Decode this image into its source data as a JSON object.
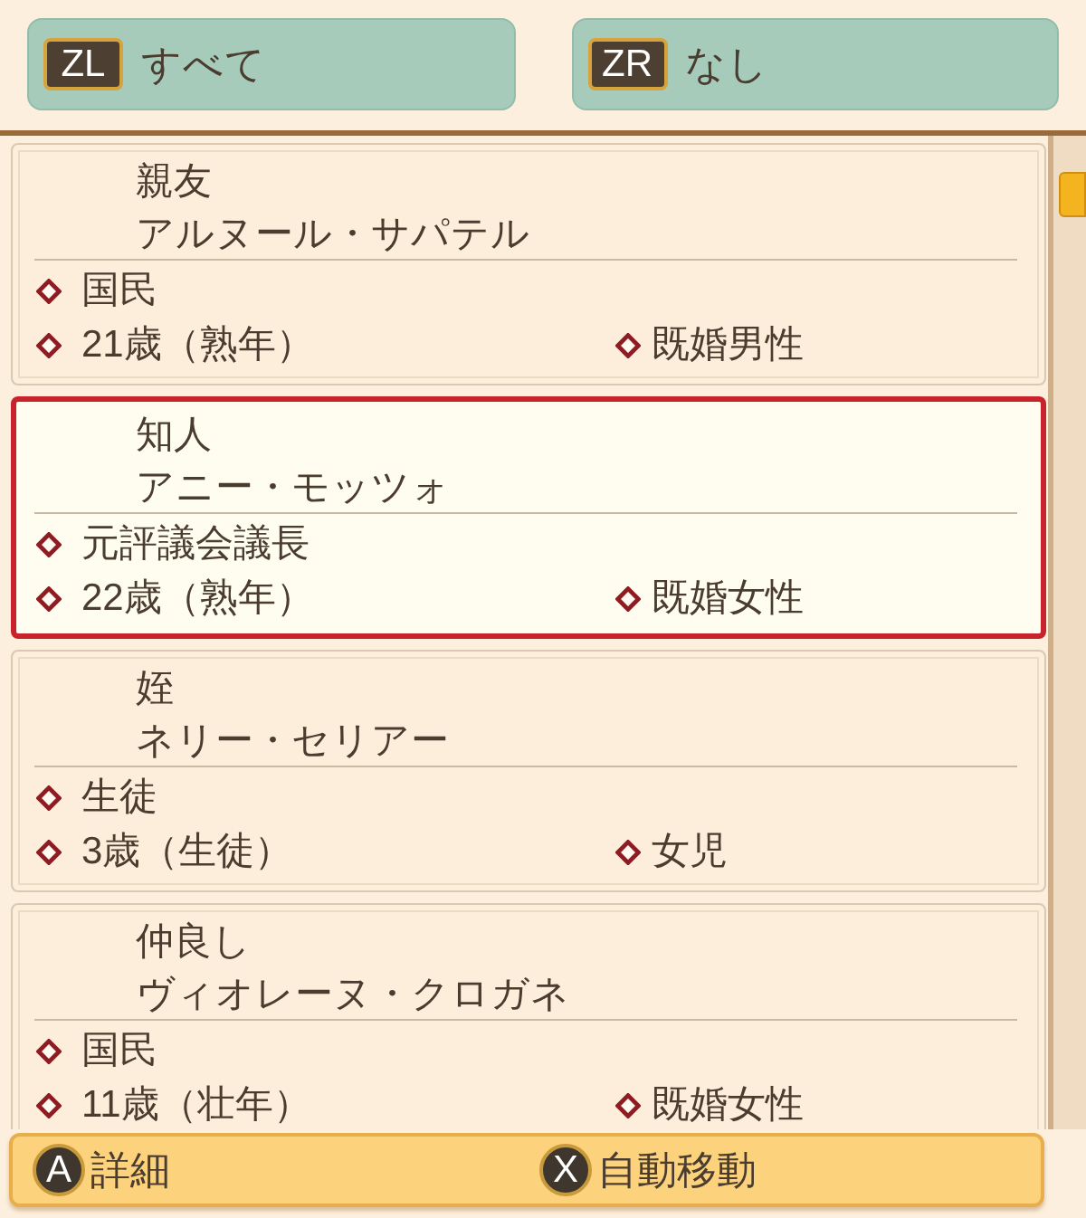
{
  "filter_buttons": [
    {
      "key": "ZL",
      "label": "すべて"
    },
    {
      "key": "ZR",
      "label": "なし"
    }
  ],
  "people": [
    {
      "relation": "親友",
      "name": "アルヌール・サパテル",
      "title": "国民",
      "age": "21歳（熟年）",
      "status": "既婚男性",
      "selected": false
    },
    {
      "relation": "知人",
      "name": "アニー・モッツォ",
      "title": "元評議会議長",
      "age": "22歳（熟年）",
      "status": "既婚女性",
      "selected": true
    },
    {
      "relation": "姪",
      "name": "ネリー・セリアー",
      "title": "生徒",
      "age": "3歳（生徒）",
      "status": "女児",
      "selected": false
    },
    {
      "relation": "仲良し",
      "name": "ヴィオレーヌ・クロガネ",
      "title": "国民",
      "age": "11歳（壮年）",
      "status": "既婚女性",
      "selected": false
    }
  ],
  "footer_actions": [
    {
      "key": "A",
      "label": "詳細"
    },
    {
      "key": "X",
      "label": "自動移動"
    }
  ]
}
